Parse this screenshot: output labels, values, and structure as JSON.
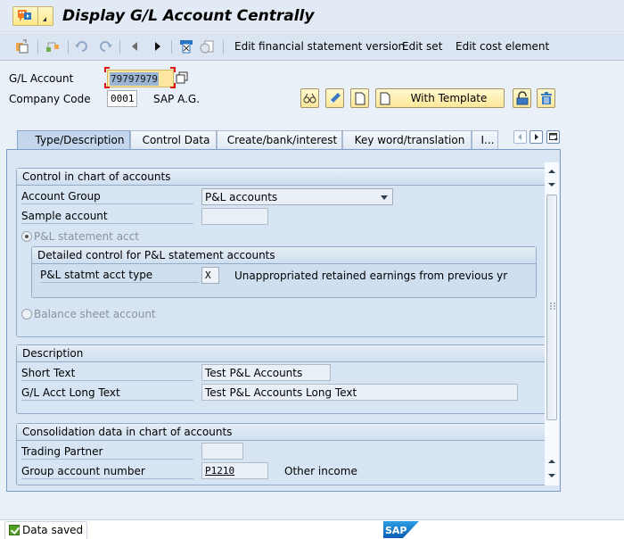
{
  "window": {
    "title": "Display G/L Account Centrally"
  },
  "toolbar": {
    "icons": [
      "copy-icon",
      "hierarchy-icon",
      "undo-icon",
      "redo-icon",
      "previous-icon",
      "next-icon",
      "print-icon",
      "display-document-icon"
    ],
    "edit_fs_version": "Edit financial statement version",
    "edit_set": "Edit set",
    "edit_cost_element": "Edit cost element"
  },
  "header": {
    "gl_account_label": "G/L Account",
    "gl_account_value": "79797979",
    "company_code_label": "Company Code",
    "company_code_value": "0001",
    "company_name": "SAP A.G.",
    "buttons": {
      "display": "display-icon",
      "change": "pencil-icon",
      "create": "new-document-icon",
      "with_template": "With Template",
      "lock": "lock-icon",
      "delete": "trash-icon"
    }
  },
  "tabs": [
    {
      "label": "Type/Description",
      "active": true
    },
    {
      "label": "Control Data",
      "active": false
    },
    {
      "label": "Create/bank/interest",
      "active": false
    },
    {
      "label": "Key word/translation",
      "active": false
    },
    {
      "label": "I...",
      "active": false
    }
  ],
  "control_group": {
    "title": "Control in chart of accounts",
    "account_group_label": "Account Group",
    "account_group_value": "P&L accounts",
    "sample_account_label": "Sample account",
    "sample_account_value": "",
    "pl_radio_label": "P&L statement acct",
    "pl_radio_selected": true,
    "detailed": {
      "title": "Detailed control for P&L statement accounts",
      "type_label": "P&L statmt acct type",
      "type_value": "X",
      "type_description": "Unappropriated retained earnings from previous yr"
    },
    "bs_radio_label": "Balance sheet account",
    "bs_radio_selected": false
  },
  "description_group": {
    "title": "Description",
    "short_text_label": "Short Text",
    "short_text_value": "Test P&L Accounts",
    "long_text_label": "G/L Acct Long Text",
    "long_text_value": "Test P&L Accounts Long Text"
  },
  "consolidation_group": {
    "title": "Consolidation data in chart of accounts",
    "trading_partner_label": "Trading Partner",
    "trading_partner_value": "",
    "group_account_label": "Group account number",
    "group_account_value": "P1210",
    "group_account_description": "Other income"
  },
  "status": {
    "message": "Data saved",
    "type": "success"
  },
  "logo": "SAP"
}
